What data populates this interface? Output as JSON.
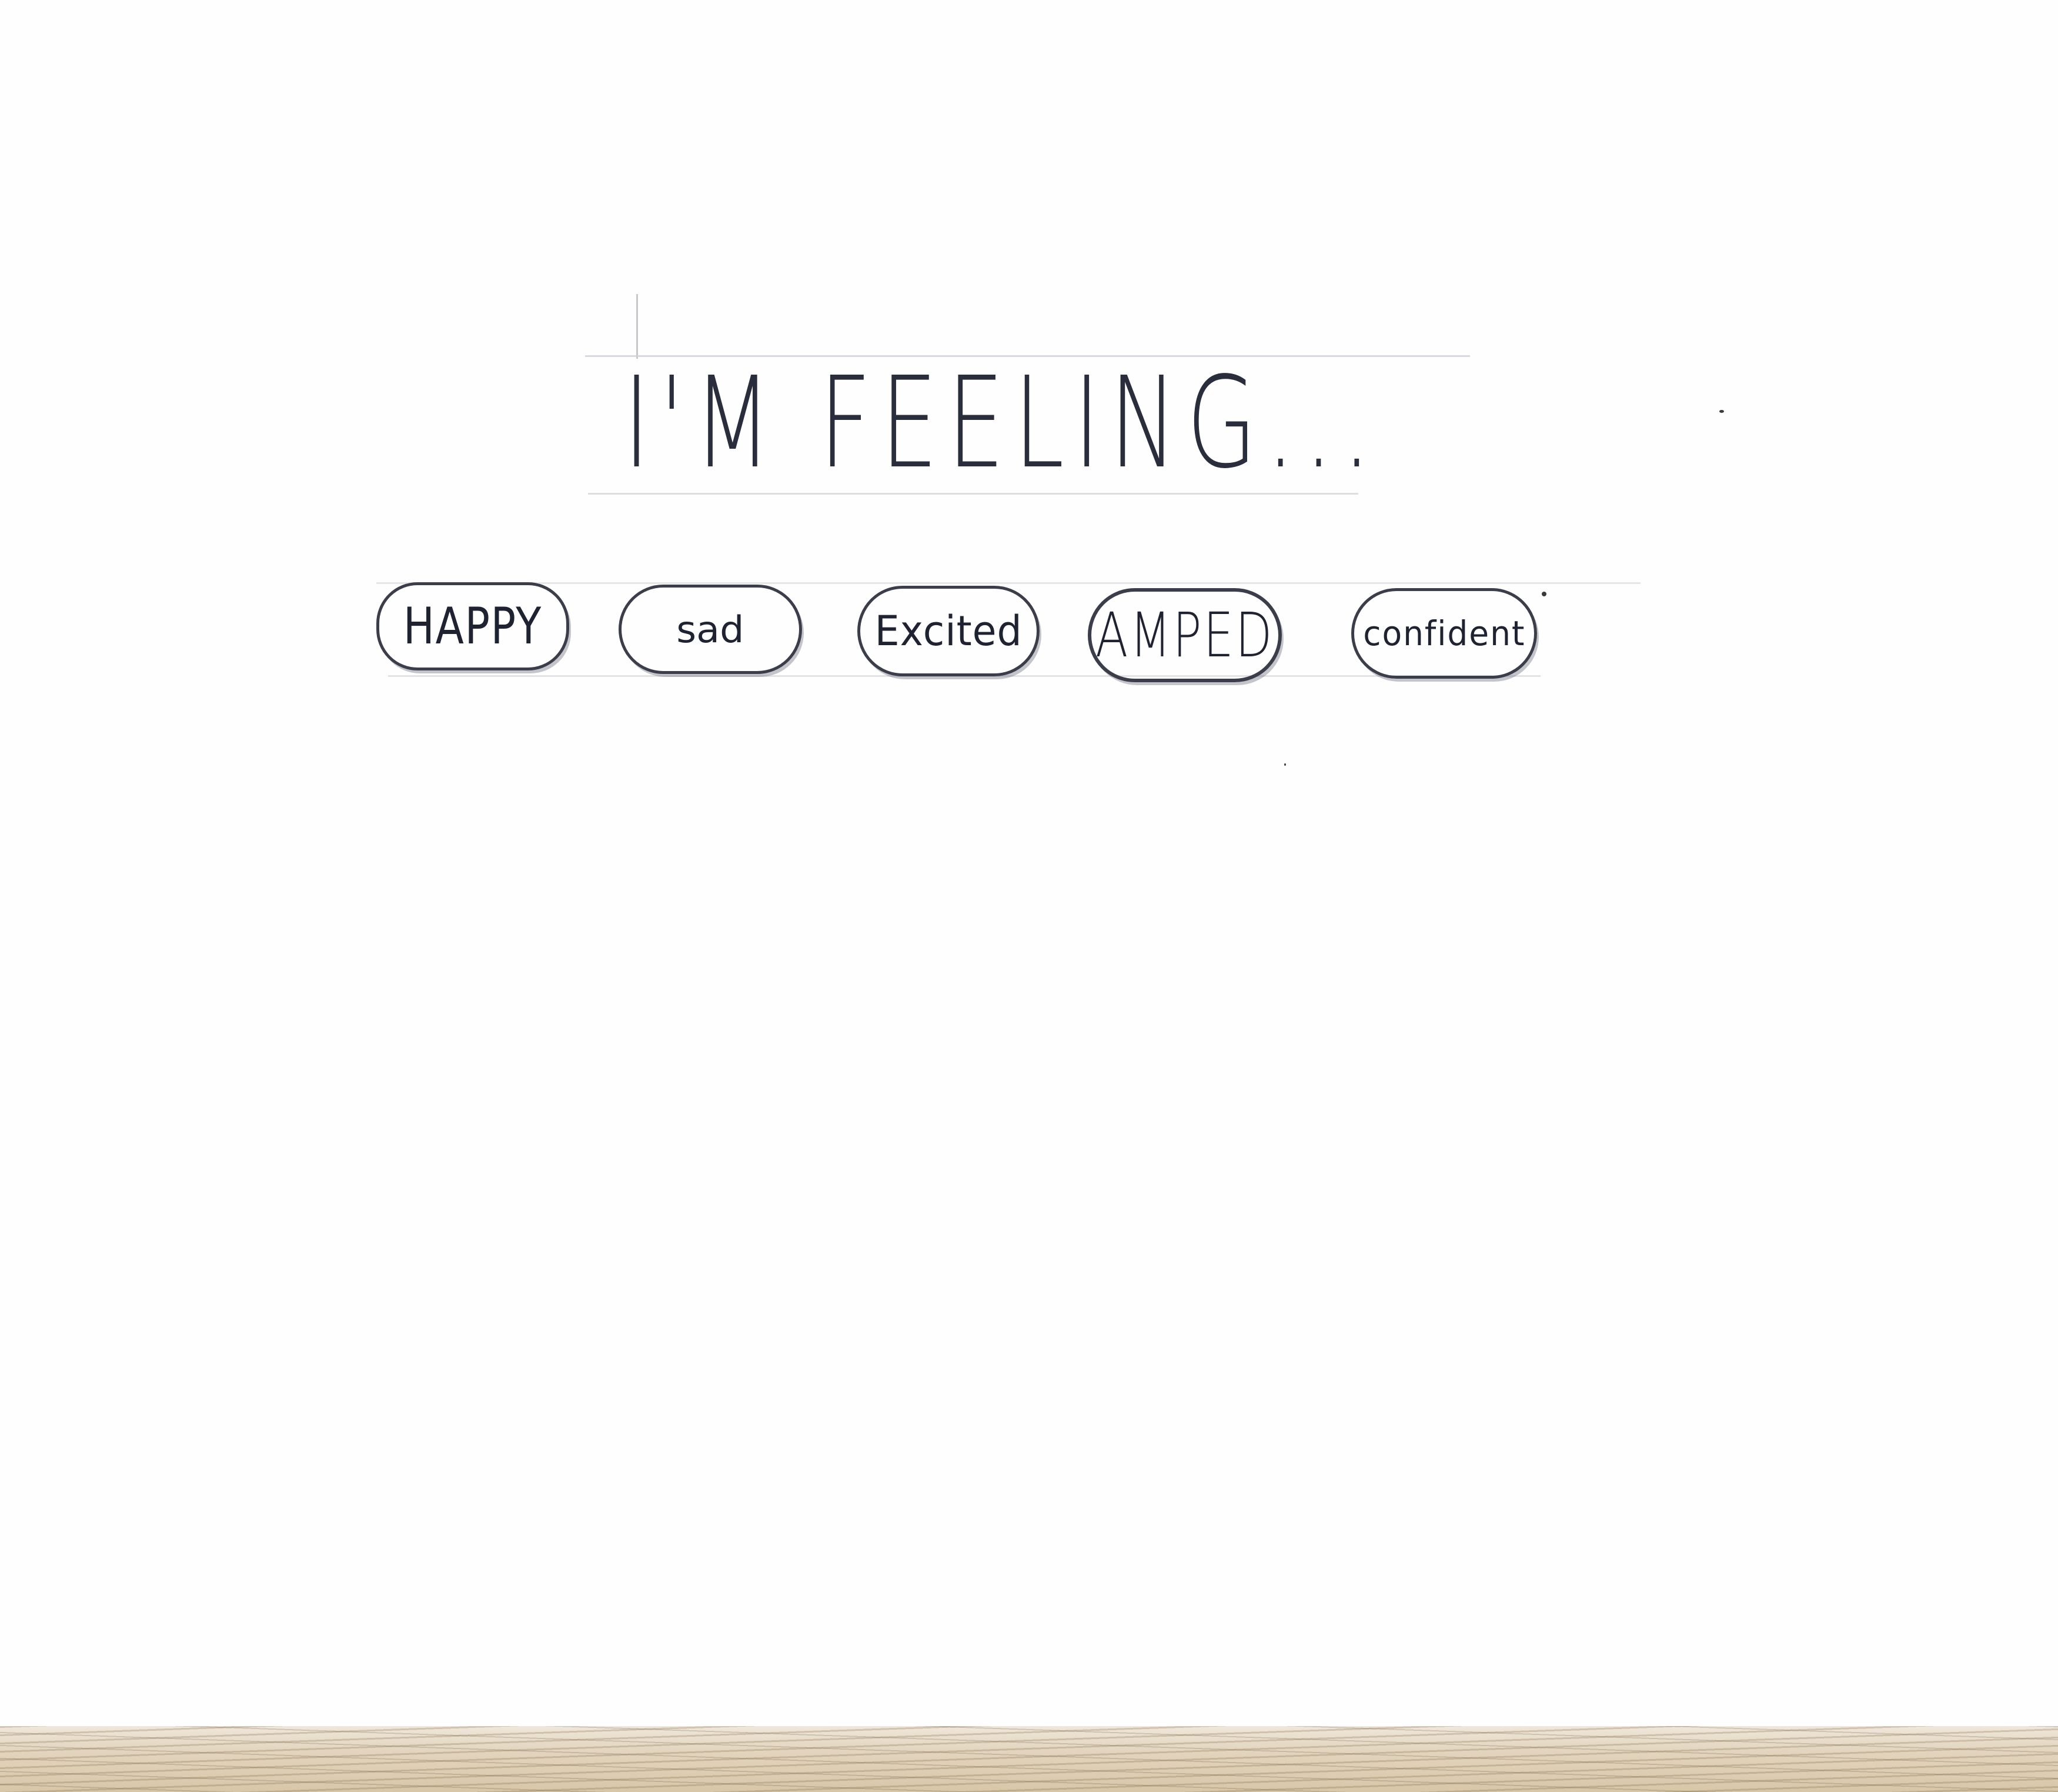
{
  "header": {
    "title": "I'M FEELING..."
  },
  "moods": {
    "happy": "HAPPY",
    "sad": "sad",
    "excited": "Excited",
    "amped": "AMPED",
    "confident": "confident"
  },
  "colors": {
    "ink": "#2a2e3c",
    "paper": "#fefefe",
    "guide_line": "#cfcfd4"
  }
}
